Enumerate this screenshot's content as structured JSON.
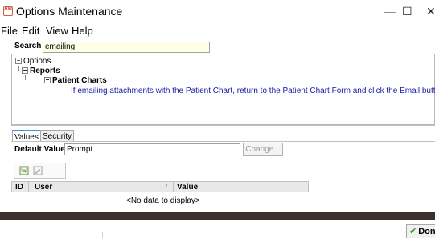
{
  "window": {
    "title": "Options Maintenance",
    "app_icon_text": "AVI",
    "minimize_glyph": "—",
    "maximize_glyph": "☐",
    "close_glyph": "✕"
  },
  "menu": [
    "File",
    "Edit",
    "View",
    "Help"
  ],
  "search": {
    "label": "Search",
    "value": "emailing"
  },
  "tree": {
    "root": "Options",
    "reports": "Reports",
    "patient_charts": "Patient Charts",
    "leaf": "If emailing attachments with the Patient Chart, return to the Patient Chart Form and click the Email button",
    "expander_glyph": "−",
    "accent": "#1a1aa8"
  },
  "tabs": [
    {
      "label": "Values",
      "active": true
    },
    {
      "label": "Security",
      "active": false
    }
  ],
  "values": {
    "default_label": "Default Value",
    "default_value": "Prompt",
    "change_label": "Change..."
  },
  "toolbar": {
    "icons": [
      "save-icon",
      "edit-icon"
    ]
  },
  "grid": {
    "columns": [
      "ID",
      "User",
      "Value"
    ],
    "sort_glyph": "/",
    "empty_text": "<No data to display>"
  },
  "footer": {
    "done_label": "Done",
    "done_icon": "✔"
  },
  "colors": {
    "dark_strip": "#3c2f2f",
    "tab_accent": "#4a90d9",
    "search_bg": "#ffffe6"
  }
}
